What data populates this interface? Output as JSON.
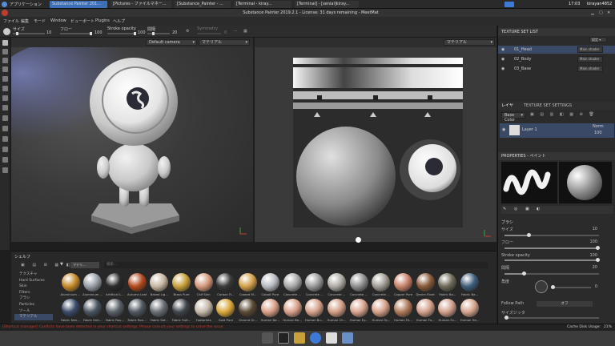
{
  "topbar": {
    "apps_label": "アプリケーション",
    "tabs": [
      "Substance Painter 201...",
      "[Pictures - ファイルマネー...",
      "[Substance_Painter - ...",
      "[Terminal - kiray...",
      "[Terminal] - [xenial]kiray..."
    ],
    "clock": "17:03",
    "user": "kirayan4852"
  },
  "window_title": "Substance Painter 2019.2.1 - License: 31 days remaining - MeetMat",
  "menu": [
    "ファイル",
    "編集",
    "モード",
    "Window",
    "ビューポート",
    "Plugins",
    "ヘルプ"
  ],
  "toolbar": {
    "size_label": "サイズ",
    "size_value": "10",
    "flow_label": "フロー",
    "flow_value": "100",
    "opacity_label": "Stroke opacity",
    "opacity_value": "100",
    "spacing_label": "間隔",
    "spacing_value": "20",
    "symmetry_label": "Symmetry",
    "symmetry_value": "0"
  },
  "viewport3d": {
    "camera": "Default camera",
    "channel": "マテリアル"
  },
  "viewport2d": {
    "channel": "マテリアル"
  },
  "texture_set_list": {
    "title": "TEXTURE SET LIST",
    "settings_label": "設定 ▾",
    "sets": [
      {
        "name": "01_Head",
        "shader": "Main shader"
      },
      {
        "name": "02_Body",
        "shader": "Main shader"
      },
      {
        "name": "03_Base",
        "shader": "Main shader"
      }
    ]
  },
  "layers": {
    "tab_layers": "レイヤ",
    "tab_settings": "TEXTURE SET SETTINGS",
    "channel": "Base Color",
    "layer_name": "Layer 1",
    "blend": "Norm",
    "opacity": "100"
  },
  "properties": {
    "title": "PROPERTIES - ペイント",
    "section": "ブラシ",
    "size_label": "サイズ",
    "size_value": "10",
    "flow_label": "フロー",
    "flow_value": "100",
    "opacity_label": "Stroke opacity",
    "opacity_value": "100",
    "spacing_label": "間隔",
    "spacing_value": "20",
    "angle_label": "角度",
    "angle_value": "0",
    "follow_label": "Follow Path",
    "follow_value": "オフ",
    "jitter_label": "サイズジッタ"
  },
  "shelf": {
    "title": "シェルフ",
    "filter_tag": "マテリ...",
    "search_placeholder": "検索...",
    "categories": [
      "テクスチャ",
      "Hard Surfaces",
      "Skin",
      "Filters",
      "ブラシ",
      "Particles",
      "ツール",
      "マテリアル"
    ],
    "materials_row1": [
      {
        "name": "Aluminium ...",
        "color": "#c58a2a"
      },
      {
        "name": "Aluminium ...",
        "color": "#9aa0a8"
      },
      {
        "name": "Artificial L...",
        "color": "#2b2b2b"
      },
      {
        "name": "Autumn Leaf",
        "color": "#b34a1e"
      },
      {
        "name": "Baked Lig...",
        "color": "#c9b7a3"
      },
      {
        "name": "Brass Pure",
        "color": "#c9a13b"
      },
      {
        "name": "Calf Skin",
        "color": "#d59a7a"
      },
      {
        "name": "Carbon Fi...",
        "color": "#3b3b3b"
      },
      {
        "name": "Coated M...",
        "color": "#d4a04a"
      },
      {
        "name": "Cobalt Pure",
        "color": "#b8bcc2"
      },
      {
        "name": "Concrete ...",
        "color": "#a9a9a9"
      },
      {
        "name": "Concrete ...",
        "color": "#9a9a9a"
      },
      {
        "name": "Concrete ...",
        "color": "#b0aca4"
      },
      {
        "name": "Concrete ...",
        "color": "#8f8f8f"
      },
      {
        "name": "Concrete ...",
        "color": "#a39e94"
      },
      {
        "name": "Copper Pure",
        "color": "#c9826a"
      },
      {
        "name": "Denim Rivet",
        "color": "#8a5a3a"
      },
      {
        "name": "Fabric Ba...",
        "color": "#6f6a5a"
      },
      {
        "name": "Fabric Ba...",
        "color": "#3f5f7a"
      }
    ],
    "materials_row2": [
      {
        "name": "Fabric Den...",
        "color": "#3a4a66"
      },
      {
        "name": "Fabric Knit...",
        "color": "#4a5560"
      },
      {
        "name": "Fabric Rou...",
        "color": "#5a6068"
      },
      {
        "name": "Fabric Rou...",
        "color": "#505860"
      },
      {
        "name": "Fabric Sof...",
        "color": "#6a6f75"
      },
      {
        "name": "Fabric Suit...",
        "color": "#3f444a"
      },
      {
        "name": "Footprints",
        "color": "#c4b8a8"
      },
      {
        "name": "Gold Pure",
        "color": "#d9a83a"
      },
      {
        "name": "Ground Gr...",
        "color": "#5a4a35"
      },
      {
        "name": "Human Ba...",
        "color": "#d9a088"
      },
      {
        "name": "Human Be...",
        "color": "#d8a08a"
      },
      {
        "name": "Human Bu...",
        "color": "#d6a28c"
      },
      {
        "name": "Human Ch...",
        "color": "#d49e86"
      },
      {
        "name": "Human Ey...",
        "color": "#d8a48e"
      },
      {
        "name": "Human Fa...",
        "color": "#d6a088"
      },
      {
        "name": "Human Fe...",
        "color": "#b07a5a"
      },
      {
        "name": "Human Fo...",
        "color": "#d4a08a"
      },
      {
        "name": "Human Fo...",
        "color": "#d2a08c"
      },
      {
        "name": "Human He...",
        "color": "#d6a48e"
      }
    ]
  },
  "status": {
    "warning": "[Shortcut manager] Conflicts have been detected in your shortcut settings. Please consult your settings to solve the issue.",
    "cache_label": "Cache Disk Usage:",
    "cache_value": "21%"
  },
  "colors": {
    "accent": "#2f6fc6",
    "warning_text": "#c43b2e",
    "active_tab": "#3c6fb7"
  }
}
